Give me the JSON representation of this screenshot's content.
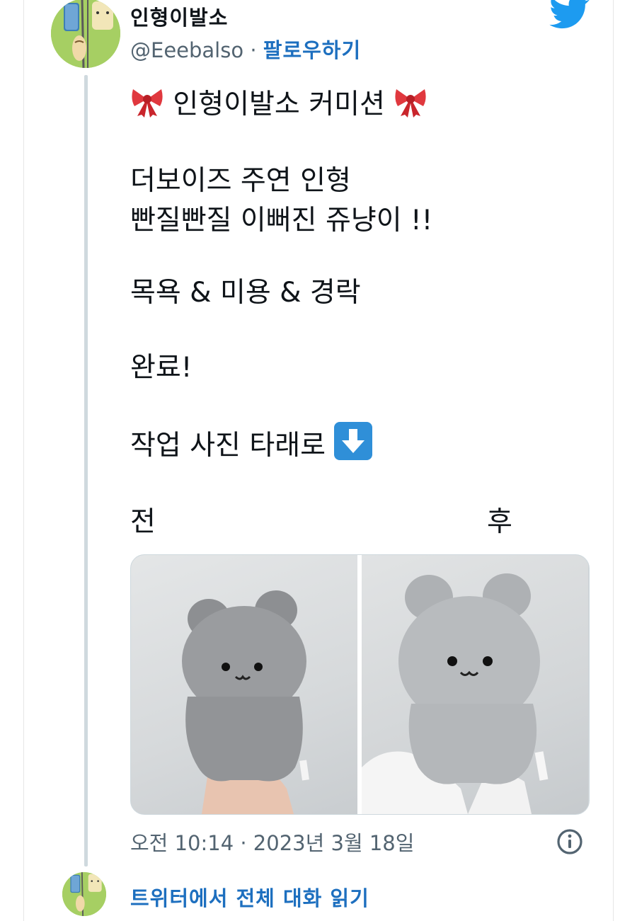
{
  "user": {
    "display_name": "인형이발소",
    "handle": "@Eeebalso",
    "separator": " · ",
    "follow_label": "팔로우하기"
  },
  "tweet": {
    "line1_text": " 인형이발소 커미션 ",
    "line2": "더보이즈 주연 인형",
    "line3": "빤질빤질 이뻐진 쥬냥이 !!",
    "line4": "목욕 & 미용 & 경락",
    "line5": "완료!",
    "line6_text": "작업 사진 타래로 ",
    "emoji": {
      "bow": "ribbon-emoji",
      "arrow": "down-arrow-emoji"
    }
  },
  "media": {
    "before_label": "전",
    "after_label": "후"
  },
  "meta": {
    "timestamp": "오전 10:14 · 2023년 3월 18일"
  },
  "footer": {
    "read_more_label": "트위터에서 전체 대화 읽기"
  },
  "icons": {
    "brand": "twitter-bird-icon",
    "info": "info-icon"
  },
  "colors": {
    "link": "#1d6fbf",
    "secondary_text": "#536471",
    "twitter_blue": "#1d9bf0",
    "thread_line": "#cfd9de"
  }
}
